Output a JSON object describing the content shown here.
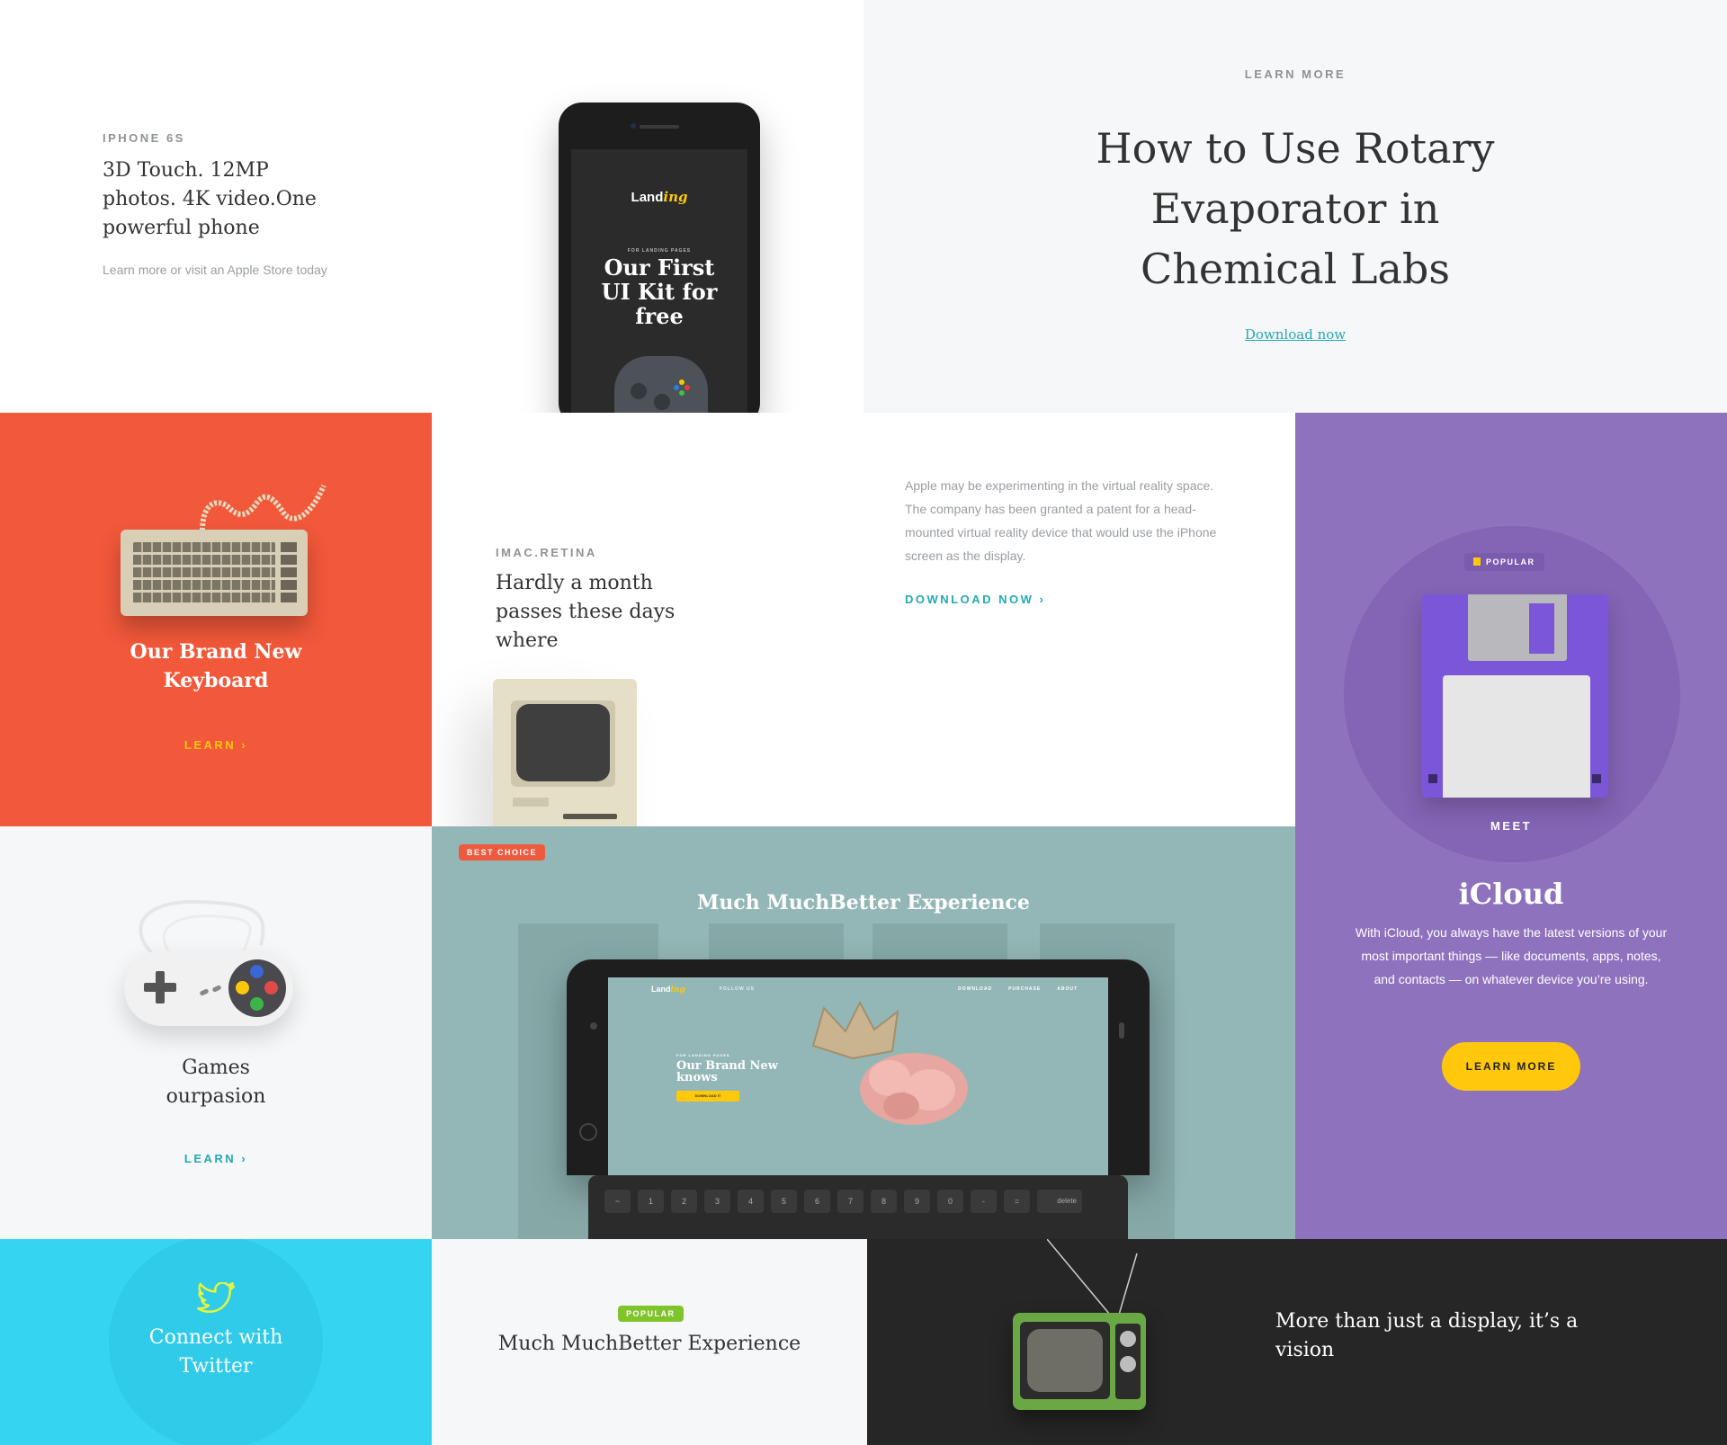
{
  "iphone": {
    "eyebrow": "IPHONE 6S",
    "title": "3D Touch. 12MP photos. 4K video.One powerful phone",
    "subtitle": "Learn more or visit an Apple Store today",
    "screen_logo": "Land",
    "screen_logo_accent": "ing",
    "screen_small": "FOR LANDING PAGES",
    "screen_headline": "Our First UI Kit for free"
  },
  "rotary": {
    "eyebrow": "LEARN MORE",
    "title": "How to Use Rotary Evaporator in Chemical Labs",
    "link": "Download now"
  },
  "keyboard": {
    "title": "Our Brand New Keyboard",
    "link": "LEARN ›"
  },
  "imac": {
    "eyebrow": "IMAC.RETINA",
    "title": "Hardly a month passes these days where"
  },
  "vr": {
    "body": "Apple may be experimenting in the virtual reality space. The company has been granted a patent for a head-mounted virtual reality device that would use the iPhone screen as the display.",
    "link": "DOWNLOAD NOW ›"
  },
  "icloud": {
    "badge": "POPULAR",
    "meet": "MEET",
    "title": "iCloud",
    "body": "With iCloud, you always have the latest versions of your most important things — like documents, apps, notes, and contacts — on whatever device you’re using.",
    "button": "LEARN MORE"
  },
  "games": {
    "title": "Games ourpasion",
    "link": "LEARN ›"
  },
  "ipad": {
    "badge": "BEST CHOICE",
    "title": "Much MuchBetter Experience",
    "screen_logo": "Land",
    "screen_logo_accent": "ing",
    "screen_follow": "FOLLOW US",
    "screen_nav": [
      "DOWNLOAD",
      "PURCHASE",
      "ABOUT"
    ],
    "screen_small": "FOR LANDING PAGES",
    "screen_headline": "Our Brand New knows",
    "screen_button": "DOWNLOAD IT",
    "keys": [
      "~",
      "1",
      "2",
      "3",
      "4",
      "5",
      "6",
      "7",
      "8",
      "9",
      "0",
      "-",
      "=",
      "delete"
    ]
  },
  "twitter": {
    "title": "Connect with Twitter"
  },
  "popular": {
    "badge": "POPULAR",
    "title": "Much MuchBetter Experience"
  },
  "display": {
    "title": "More than just a display, it’s a vision"
  },
  "colors": {
    "accent_teal": "#23a9b3",
    "accent_yellow": "#ffc80a",
    "orange": "#f2583a",
    "purple": "#8e72bd",
    "teal_bg": "#93b7b6",
    "cyan": "#35d5f2",
    "dark": "#262626",
    "badge_green": "#80c42b",
    "badge_red": "#ee5a3e"
  }
}
